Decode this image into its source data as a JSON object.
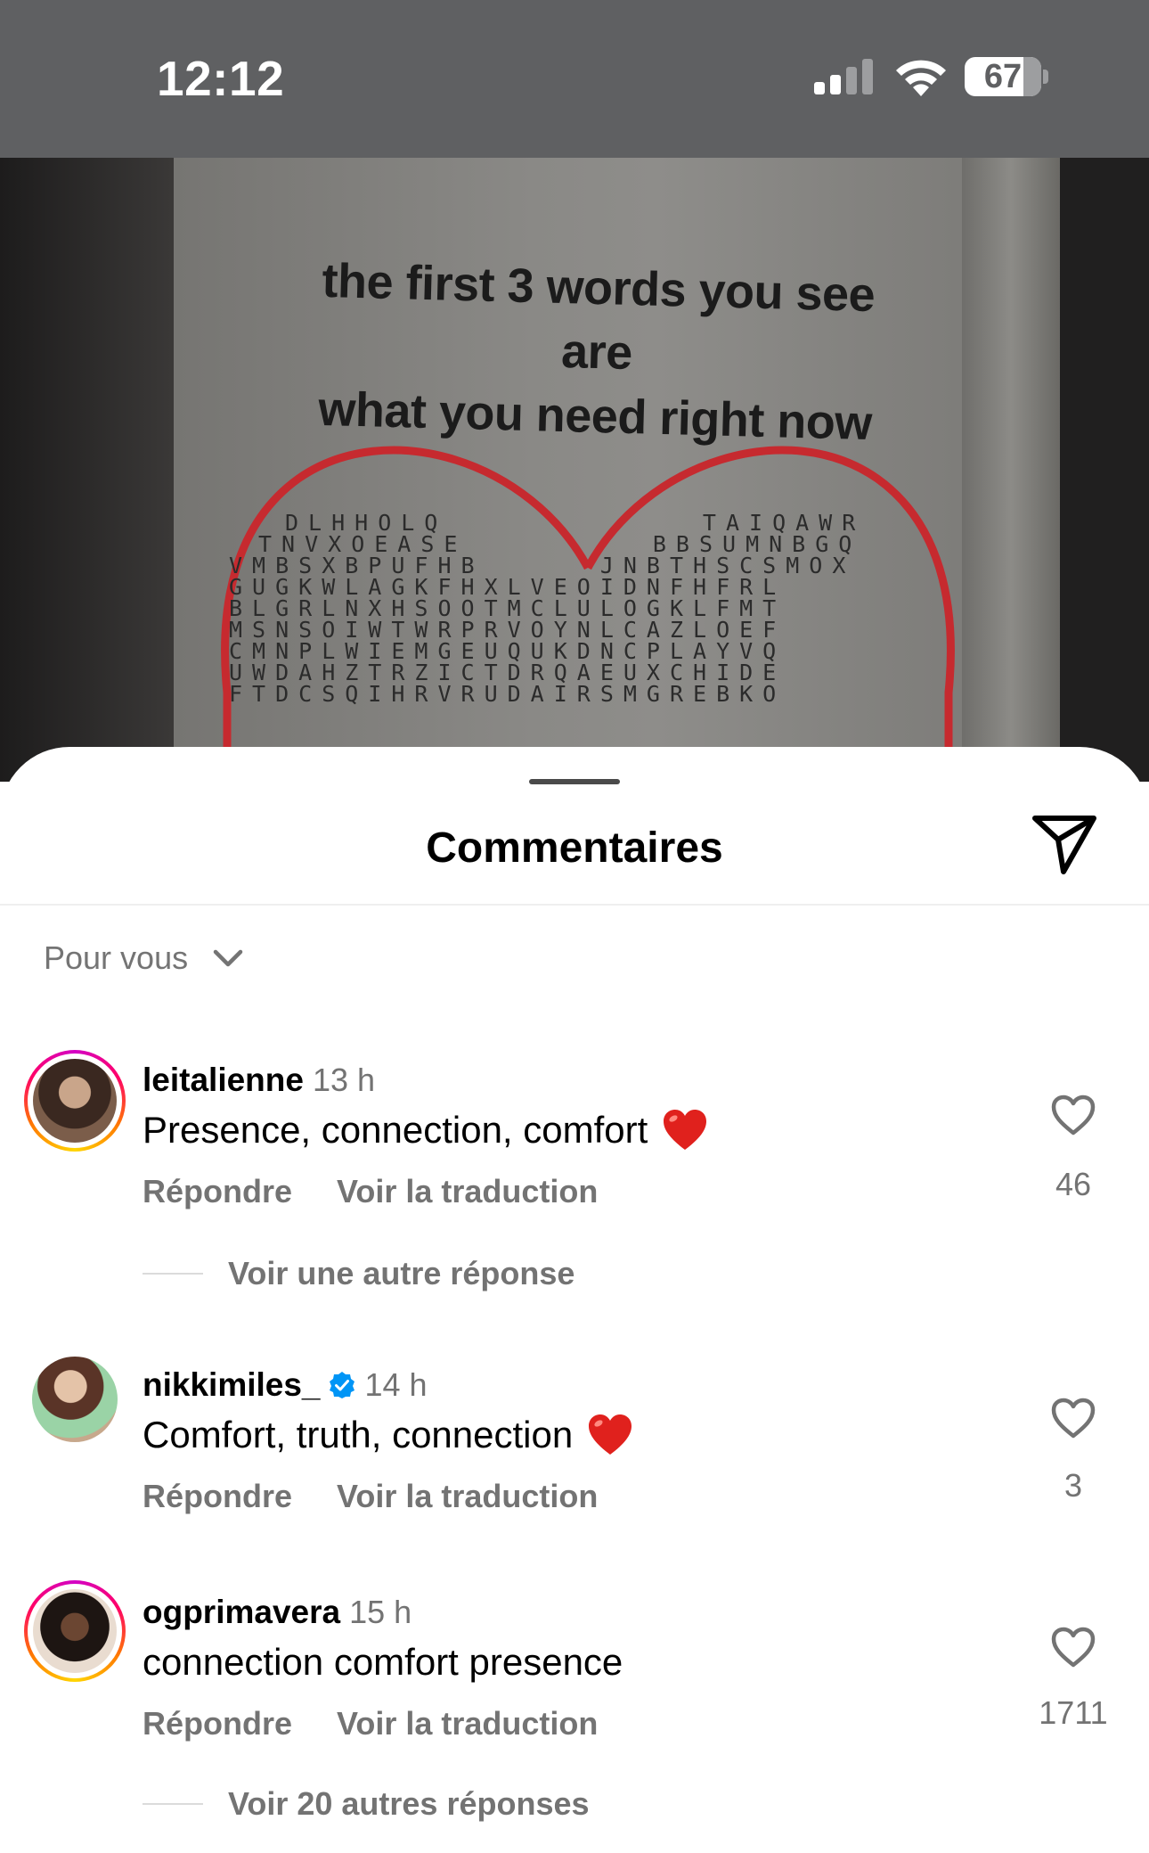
{
  "status_bar": {
    "time": "12:12",
    "battery_percent": "67",
    "signal_bars_active": 2,
    "signal_bars_total": 4
  },
  "photo": {
    "heading_line1": "the first 3 words you see are",
    "heading_line2": "what you need right now",
    "heart_color": "#c62a2f",
    "letter_grid": [
      "DLHHOLQ           TAIQAWR",
      "TNVXOEASE        BBSUMNBGQ",
      "VMBSXBPUFHB     JNBTHSCSMOX",
      "GUGKWLAGKFHXLVEOIDNFHFRL",
      "BLGRLNXHSOOTMCLULOGKLFMT",
      "MSNSOIWTWRPRVOYNLCAZLOEF",
      "CMNPLWIEMGEUQUKDNCPLAYVQ",
      "UWDAHZTRZICTDRQAEUXCHIDE",
      "FTDCSQIHRVRUDAIRSMGREBKO"
    ]
  },
  "sheet": {
    "title": "Commentaires",
    "share_icon": "paper-plane-icon",
    "sort_label": "Pour vous",
    "sort_icon": "chevron-down-icon"
  },
  "comments": [
    {
      "username": "leitalienne",
      "time": "13 h",
      "text": "Presence, connection, comfort",
      "emoji": "❤️",
      "reply_label": "Répondre",
      "translate_label": "Voir la traduction",
      "likes": "46",
      "more_replies": "Voir une autre réponse",
      "verified": false,
      "story_ring": true
    },
    {
      "username": "nikkimiles_",
      "time": "14 h",
      "text": "Comfort, truth, connection",
      "emoji": "❤️",
      "reply_label": "Répondre",
      "translate_label": "Voir la traduction",
      "likes": "3",
      "verified": true,
      "story_ring": false
    },
    {
      "username": "ogprimavera",
      "time": "15 h",
      "text": "connection comfort presence",
      "reply_label": "Répondre",
      "translate_label": "Voir la traduction",
      "likes": "1711",
      "more_replies": "Voir 20 autres réponses",
      "verified": false,
      "story_ring": true
    }
  ],
  "colors": {
    "status_bar_bg": "#5f6062",
    "secondary_text": "#737373",
    "verified_blue": "#0095f6",
    "heart_red": "#e0211d"
  }
}
